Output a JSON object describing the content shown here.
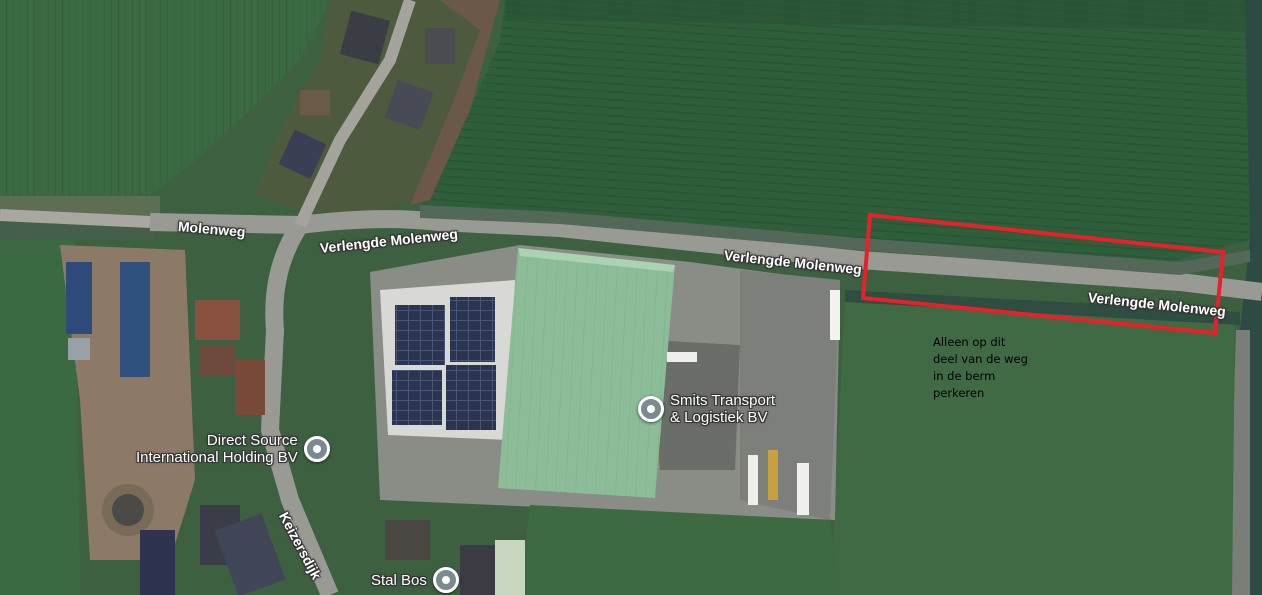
{
  "roads": {
    "molenweg": "Molenweg",
    "verlengde_west": "Verlengde Molenweg",
    "verlengde_mid": "Verlengde Molenweg",
    "verlengde_east": "Verlengde Molenweg",
    "keizersdijk": "Keizersdijk"
  },
  "pois": {
    "smits": {
      "line1": "Smits Transport",
      "line2": "& Logistiek BV",
      "icon": "place-pin-icon"
    },
    "direct_source": {
      "line1": "Direct Source",
      "line2": "International Holding BV",
      "icon": "place-pin-icon"
    },
    "stal_bos": {
      "line1": "Stal Bos",
      "icon": "place-pin-icon"
    }
  },
  "annotation": {
    "lines": [
      "Alleen op dit",
      "deel van de weg",
      "in de berm",
      "perkeren"
    ],
    "highlight_color": "#e8202a"
  },
  "colors": {
    "field_dark": "#2f5a3a",
    "field_light": "#3f6b43",
    "road": "#9a9a94",
    "warehouse_roof": "#8fbf9a"
  }
}
